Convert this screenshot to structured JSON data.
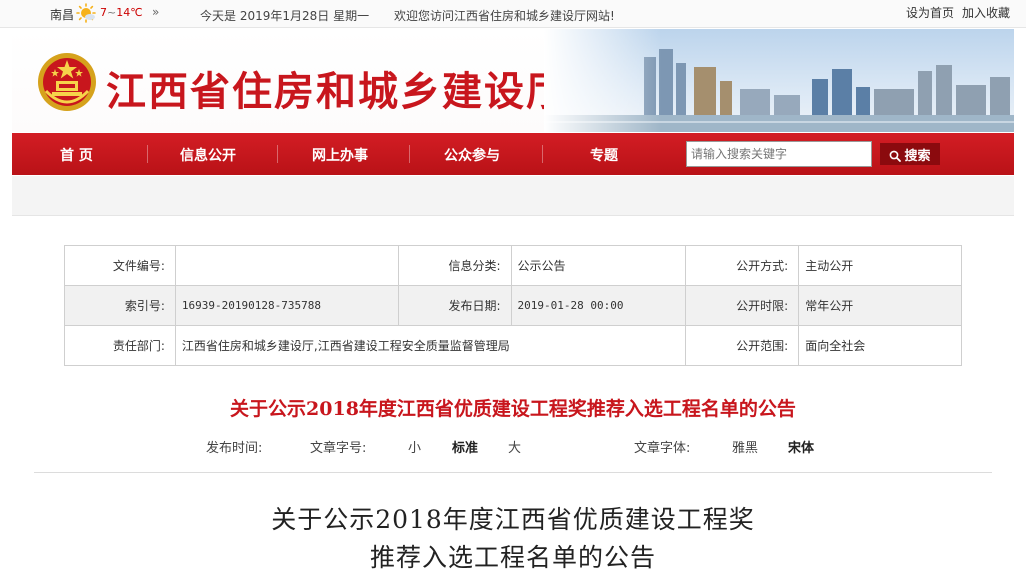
{
  "topbar": {
    "city": "南昌",
    "temp_low": "7",
    "temp_sep": "~",
    "temp_high": "14℃",
    "more_arrow": "»",
    "today": "今天是  2019年1月28日  星期一",
    "welcome": "欢迎您访问江西省住房和城乡建设厅网站!",
    "set_home": "设为首页",
    "add_fav": "加入收藏"
  },
  "banner": {
    "title": "江西省住房和城乡建设厅"
  },
  "nav": {
    "items": [
      "首 页",
      "信息公开",
      "网上办事",
      "公众参与",
      "专题"
    ],
    "search_placeholder": "请输入搜索关键字",
    "search_button": "搜索"
  },
  "meta": {
    "rows": [
      [
        {
          "label": "文件编号:",
          "value": ""
        },
        {
          "label": "信息分类:",
          "value": "公示公告"
        },
        {
          "label": "公开方式:",
          "value": "主动公开"
        }
      ],
      [
        {
          "label": "索引号:",
          "value": "16939-20190128-735788"
        },
        {
          "label": "发布日期:",
          "value": "2019-01-28 00:00"
        },
        {
          "label": "公开时限:",
          "value": "常年公开"
        }
      ],
      [
        {
          "label": "责任部门:",
          "value": "江西省住房和城乡建设厅,江西省建设工程安全质量监督管理局"
        },
        {
          "label": "公开范围:",
          "value": "面向全社会"
        }
      ]
    ]
  },
  "article": {
    "headline": "关于公示2018年度江西省优质建设工程奖推荐入选工程名单的公告",
    "publish_time_label": "发布时间:",
    "font_size_label": "文章字号:",
    "size_small": "小",
    "size_standard": "标准",
    "size_large": "大",
    "font_face_label": "文章字体:",
    "font_yahei": "雅黑",
    "font_song": "宋体",
    "doc_title_line1": "关于公示2018年度江西省优质建设工程奖",
    "doc_title_line2": "推荐入选工程名单的公告"
  },
  "colors": {
    "brand_red": "#c8161d",
    "nav_red": "#c8161d",
    "search_button": "#8b0a0e"
  }
}
